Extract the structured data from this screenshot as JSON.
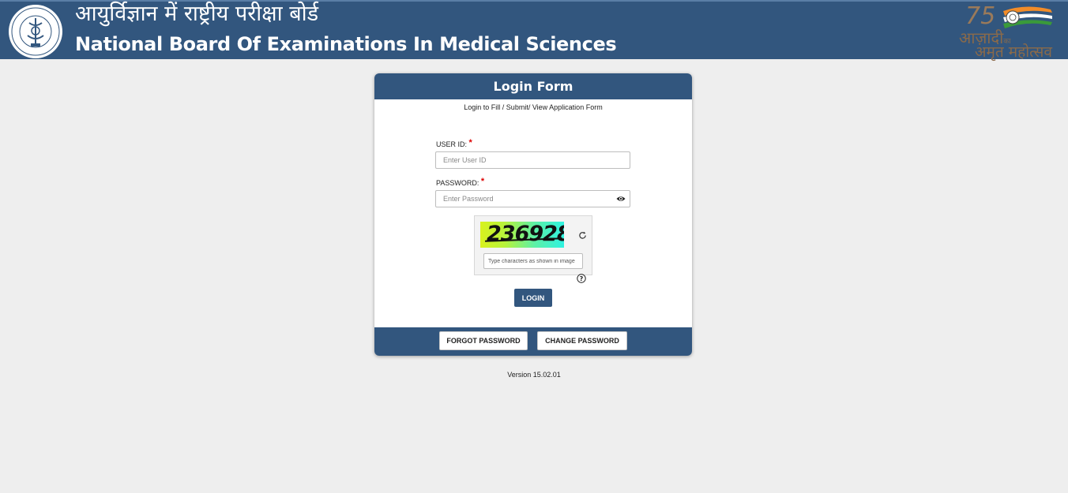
{
  "header": {
    "title_hindi": "आयुर्विज्ञान में राष्ट्रीय परीक्षा बोर्ड",
    "title_en": "National Board Of Examinations In Medical Sciences",
    "azadi_line1": "आज़ादी",
    "azadi_small": "का",
    "azadi_line2": "अमृत महोत्सव",
    "azadi_number": "75",
    "bg_color": "#32567e"
  },
  "login_form": {
    "title": "Login Form",
    "subtitle": "Login to Fill / Submit/ View Application Form",
    "user_id_label": "USER ID:",
    "user_id_placeholder": "Enter User ID",
    "password_label": "PASSWORD:",
    "password_placeholder": "Enter Password",
    "required_marker": "*",
    "captcha_text": "236928",
    "captcha_placeholder": "Type characters as shown in image",
    "help_icon": "?",
    "login_label": "LOGIN"
  },
  "footer_buttons": {
    "forgot_password": "FORGOT PASSWORD",
    "change_password": "CHANGE PASSWORD"
  },
  "version": "Version 15.02.01"
}
